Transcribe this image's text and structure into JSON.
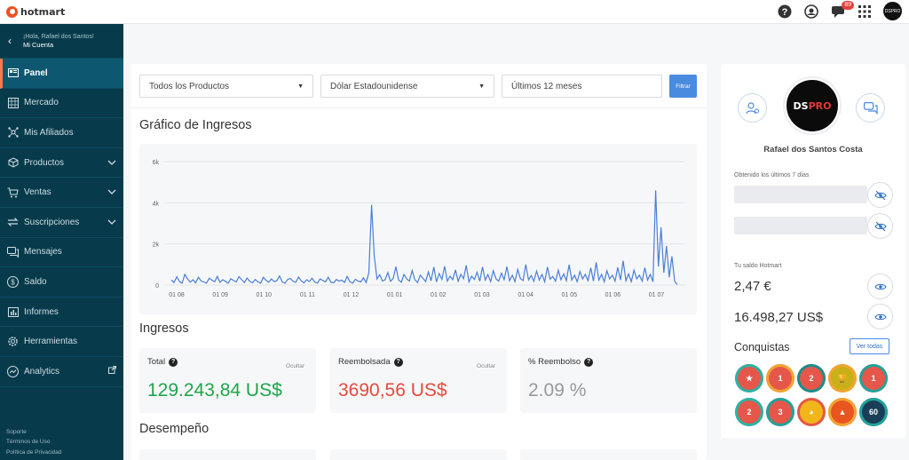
{
  "header": {
    "logo": "hotmart",
    "notifications_count": "89",
    "avatar_text": "DSPRO"
  },
  "sidebar": {
    "greeting": "¡Hola, Rafael dos Santos!",
    "account_link": "Mi Cuenta",
    "items": [
      {
        "label": "Panel",
        "icon": "panel-icon"
      },
      {
        "label": "Mercado",
        "icon": "market-icon"
      },
      {
        "label": "Mis Afiliados",
        "icon": "affiliates-icon"
      },
      {
        "label": "Productos",
        "icon": "box-icon"
      },
      {
        "label": "Ventas",
        "icon": "cart-icon"
      },
      {
        "label": "Suscripciones",
        "icon": "sync-icon"
      },
      {
        "label": "Mensajes",
        "icon": "messages-icon"
      },
      {
        "label": "Saldo",
        "icon": "dollar-icon"
      },
      {
        "label": "Informes",
        "icon": "reports-icon"
      },
      {
        "label": "Herramientas",
        "icon": "gear-icon"
      },
      {
        "label": "Analytics",
        "icon": "analytics-icon"
      }
    ],
    "footer": [
      "Soporte",
      "Términos de Uso",
      "Política de Privacidad"
    ]
  },
  "filters": {
    "products": "Todos los Productos",
    "currency": "Dólar Estadounidense",
    "period": "Últimos 12 meses",
    "button": "Filtrar"
  },
  "sections": {
    "chart_title": "Gráfico de Ingresos",
    "revenue_title": "Ingresos",
    "performance_title": "Desempeño"
  },
  "chart_data": {
    "type": "line",
    "ylim": [
      0,
      6000
    ],
    "y_ticks": [
      "0",
      "2k",
      "4k",
      "6k"
    ],
    "x_ticks": [
      "01 08",
      "01 09",
      "01 10",
      "01 11",
      "01 12",
      "01 01",
      "01 02",
      "01 03",
      "01 04",
      "01 05",
      "01 06",
      "01 07"
    ],
    "grid": true,
    "series": [
      {
        "color": "#4a7fd6",
        "values": [
          250,
          120,
          400,
          180,
          90,
          520,
          300,
          140,
          260,
          110,
          380,
          200,
          150,
          90,
          330,
          240,
          160,
          420,
          130,
          260,
          180,
          90,
          310,
          220,
          150,
          410,
          260,
          120,
          340,
          180,
          110,
          270,
          160,
          90,
          380,
          230,
          140,
          300,
          170,
          210,
          440,
          150,
          90,
          270,
          320,
          180,
          130,
          390,
          210,
          110,
          260,
          170,
          330,
          150,
          90,
          300,
          220,
          160,
          380,
          140,
          110,
          270,
          190,
          240,
          130,
          420,
          160,
          90,
          280,
          200,
          150,
          350,
          120,
          600,
          3900,
          1400,
          300,
          500,
          200,
          260,
          610,
          180,
          320,
          900,
          250,
          140,
          520,
          300,
          190,
          710,
          260,
          120,
          480,
          330,
          170,
          640,
          210,
          880,
          150,
          560,
          270,
          910,
          190,
          430,
          260,
          740,
          180,
          520,
          310,
          960,
          150,
          430,
          270,
          620,
          190,
          880,
          240,
          510,
          170,
          700,
          300,
          190,
          580,
          260,
          900,
          210,
          480,
          170,
          760,
          320,
          220,
          1000,
          250,
          460,
          180,
          680,
          240,
          520,
          160,
          880,
          290,
          420,
          190,
          720,
          260,
          540,
          210,
          990,
          240,
          480,
          170,
          660,
          300,
          520,
          210,
          840,
          190,
          1100,
          240,
          520,
          160,
          700,
          300,
          480,
          190,
          860,
          250,
          1180,
          210,
          540,
          170,
          720,
          300,
          480,
          190,
          840,
          240,
          520,
          160,
          4600,
          900,
          2800,
          600,
          1900,
          380,
          1400,
          180,
          20
        ]
      }
    ]
  },
  "stats": [
    {
      "label": "Total",
      "hide": "Ocultar",
      "value": "129.243,84 US$",
      "color": "#1ca64a"
    },
    {
      "label": "Reembolsada",
      "hide": "Ocultar",
      "value": "3690,56 US$",
      "color": "#e34b3c"
    },
    {
      "label": "% Reembolso",
      "value": "2.09 %",
      "color": "#999999"
    }
  ],
  "profile": {
    "avatar_text": "DSPRO",
    "name": "Rafael dos Santos Costa",
    "period_label": "Obtenido los últimos 7 días",
    "balance_label": "Tu saldo Hotmart",
    "balance_eur": "2,47 €",
    "balance_usd": "16.498,27 US$",
    "achievements_title": "Conquistas",
    "see_all": "Ver todas",
    "achievements": [
      {
        "color": "#e4574a",
        "ring": "#2bb3a4",
        "mark": "★"
      },
      {
        "color": "#e4574a",
        "ring": "#f2a531",
        "mark": "1"
      },
      {
        "color": "#e4574a",
        "ring": "#1a8e8e",
        "mark": "2"
      },
      {
        "color": "#c9b018",
        "ring": "#f2a531",
        "mark": "🏆"
      },
      {
        "color": "#e4574a",
        "ring": "#23a39b",
        "mark": "1"
      },
      {
        "color": "#e4574a",
        "ring": "#2bb3a4",
        "mark": "2"
      },
      {
        "color": "#e4574a",
        "ring": "#1fa39a",
        "mark": "3"
      },
      {
        "color": "#f2b61a",
        "ring": "#e4574a",
        "mark": "◕"
      },
      {
        "color": "#e8551f",
        "ring": "#f2a531",
        "mark": "▲"
      },
      {
        "color": "#1a3e57",
        "ring": "#23a39b",
        "mark": "60"
      }
    ]
  }
}
